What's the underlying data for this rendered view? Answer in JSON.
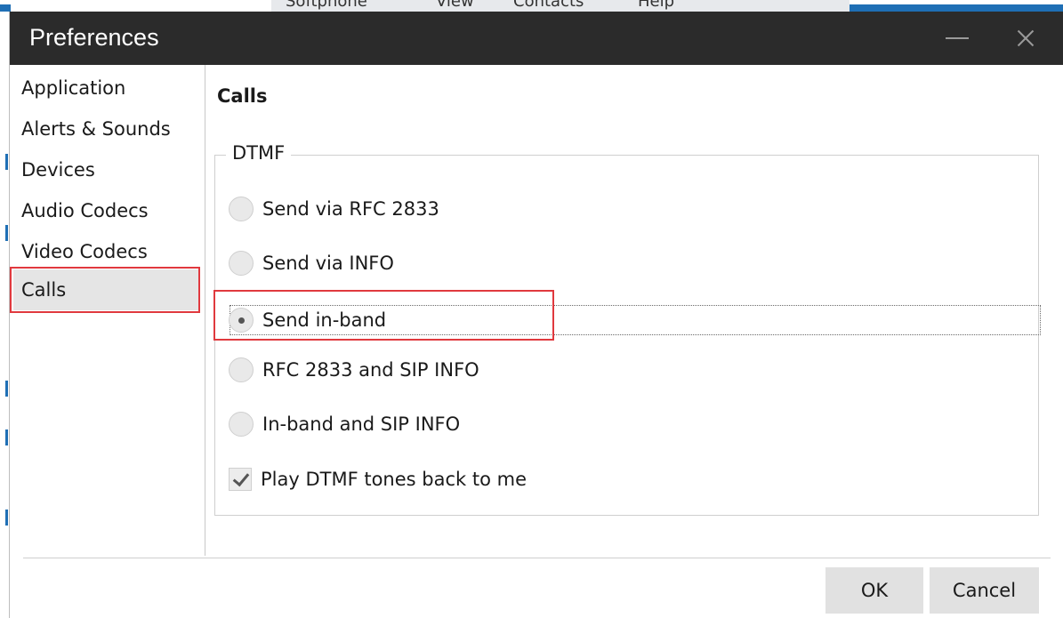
{
  "background": {
    "menu_items": [
      "Softphone",
      "View",
      "Contacts",
      "Help"
    ]
  },
  "dialog": {
    "title": "Preferences",
    "minimize_icon": "minimize-icon",
    "close_icon": "close-icon"
  },
  "sidebar": {
    "items": [
      {
        "label": "Application",
        "selected": false
      },
      {
        "label": "Alerts & Sounds",
        "selected": false
      },
      {
        "label": "Devices",
        "selected": false
      },
      {
        "label": "Audio Codecs",
        "selected": false
      },
      {
        "label": "Video Codecs",
        "selected": false
      },
      {
        "label": "Calls",
        "selected": true
      }
    ]
  },
  "content": {
    "section_title": "Calls",
    "dtmf_group": {
      "legend": "DTMF",
      "options": [
        {
          "label": "Send via RFC 2833",
          "checked": false
        },
        {
          "label": "Send via INFO",
          "checked": false
        },
        {
          "label": "Send in-band",
          "checked": true
        },
        {
          "label": "RFC 2833 and SIP INFO",
          "checked": false
        },
        {
          "label": "In-band and SIP INFO",
          "checked": false
        }
      ],
      "play_tones": {
        "label": "Play DTMF tones back to me",
        "checked": true
      }
    }
  },
  "footer": {
    "ok_label": "OK",
    "cancel_label": "Cancel"
  },
  "colors": {
    "titlebar": "#2b2b2b",
    "highlight": "#e0393e",
    "accent_blue": "#1f6fb5"
  }
}
